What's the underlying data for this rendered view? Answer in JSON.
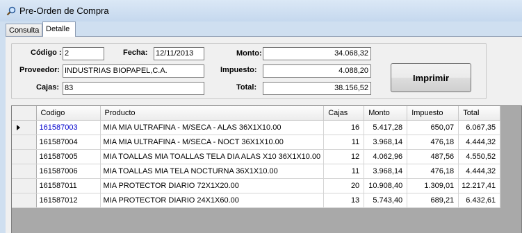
{
  "window": {
    "title": "Pre-Orden de Compra"
  },
  "tabs": [
    {
      "label": "Consulta"
    },
    {
      "label": "Detalle"
    }
  ],
  "form": {
    "codigo_label": "Código :",
    "codigo_value": "2",
    "fecha_label": "Fecha:",
    "fecha_value": "12/11/2013",
    "proveedor_label": "Proveedor:",
    "proveedor_value": "INDUSTRIAS BIOPAPEL,C.A.",
    "cajas_label": "Cajas:",
    "cajas_value": "83",
    "monto_label": "Monto:",
    "monto_value": "34.068,32",
    "impuesto_label": "Impuesto:",
    "impuesto_value": "4.088,20",
    "total_label": "Total:",
    "total_value": "38.156,52",
    "print_button": "Imprimir"
  },
  "grid": {
    "columns": [
      "Codigo",
      "Producto",
      "Cajas",
      "Monto",
      "Impuesto",
      "Total"
    ],
    "rows": [
      [
        "161587003",
        "MIA MIA ULTRAFINA - M/SECA - ALAS 36X1X10.00",
        "16",
        "5.417,28",
        "650,07",
        "6.067,35"
      ],
      [
        "161587004",
        "MIA MIA ULTRAFINA - M/SECA - NOCT 36X1X10.00",
        "11",
        "3.968,14",
        "476,18",
        "4.444,32"
      ],
      [
        "161587005",
        "MIA TOALLAS MIA TOALLAS TELA DIA ALAS X10 36X1X10.00",
        "12",
        "4.062,96",
        "487,56",
        "4.550,52"
      ],
      [
        "161587006",
        "MIA TOALLAS MIA TELA NOCTURNA 36X1X10.00",
        "11",
        "3.968,14",
        "476,18",
        "4.444,32"
      ],
      [
        "161587011",
        "MIA PROTECTOR DIARIO 72X1X20.00",
        "20",
        "10.908,40",
        "1.309,01",
        "12.217,41"
      ],
      [
        "161587012",
        "MIA PROTECTOR DIARIO 24X1X60.00",
        "13",
        "5.743,40",
        "689,21",
        "6.432,61"
      ]
    ]
  }
}
